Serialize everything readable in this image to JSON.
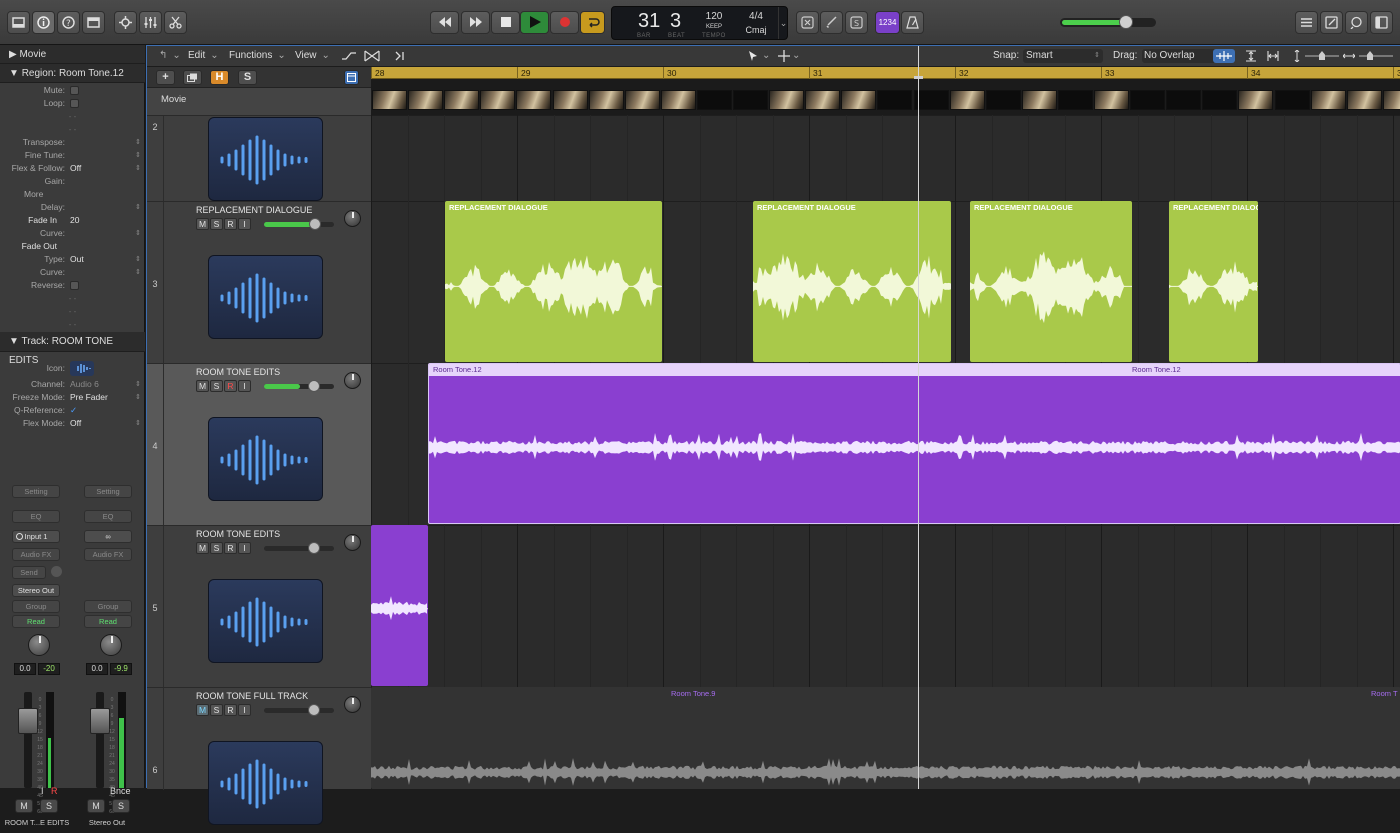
{
  "transport": {
    "bar": "31",
    "beat": "3",
    "bar_caption": "BAR",
    "beat_caption": "BEAT",
    "tempo": "120",
    "tempo_mode": "KEEP",
    "tempo_caption": "TEMPO",
    "signature": "4/4",
    "key": "Cmaj",
    "count_in": "1234"
  },
  "inspector": {
    "movie_header": "Movie",
    "region_label": "Region:",
    "region_name": "Room Tone.12",
    "region_params": [
      {
        "label": "Mute:",
        "value": ""
      },
      {
        "label": "Loop:",
        "value": ""
      },
      {
        "label": "Transpose:",
        "value": ""
      },
      {
        "label": "Fine Tune:",
        "value": ""
      },
      {
        "label": "Flex & Follow:",
        "value": "Off"
      },
      {
        "label": "Gain:",
        "value": ""
      },
      {
        "label": "More",
        "value": ""
      },
      {
        "label": "Delay:",
        "value": ""
      },
      {
        "label": "Fade In",
        "value": "20"
      },
      {
        "label": "Curve:",
        "value": ""
      },
      {
        "label": "Fade Out",
        "value": ""
      },
      {
        "label": "Type:",
        "value": "Out"
      },
      {
        "label": "Curve:",
        "value": ""
      },
      {
        "label": "Reverse:",
        "value": ""
      }
    ],
    "track_label": "Track:",
    "track_name": "ROOM TONE EDITS",
    "track_params": [
      {
        "label": "Icon:",
        "value": ""
      },
      {
        "label": "Channel:",
        "value": "Audio 6"
      },
      {
        "label": "Freeze Mode:",
        "value": "Pre Fader"
      },
      {
        "label": "Q-Reference:",
        "value": "✓"
      },
      {
        "label": "Flex Mode:",
        "value": "Off"
      }
    ]
  },
  "strips": [
    {
      "setting": "Setting",
      "eq": "EQ",
      "input": "Input 1",
      "fx": "Audio FX",
      "send": "Send",
      "output": "Stereo Out",
      "group": "Group",
      "auto": "Read",
      "vol": "0.0",
      "peak": "-20",
      "ir": [
        "I",
        "R"
      ],
      "m": "M",
      "s": "S",
      "name": "ROOM T...E EDITS"
    },
    {
      "setting": "Setting",
      "eq": "EQ",
      "input": "∞",
      "fx": "Audio FX",
      "send": "",
      "output": "",
      "group": "Group",
      "auto": "Read",
      "vol": "0.0",
      "peak": "-9.9",
      "ir": [
        "Bnce",
        ""
      ],
      "m": "M",
      "s": "S",
      "name": "Stereo Out"
    }
  ],
  "meter_scale": [
    "0",
    "3",
    "6",
    "9",
    "12",
    "15",
    "18",
    "21",
    "24",
    "30",
    "35",
    "40",
    "45",
    "50",
    "60"
  ],
  "local_menu": {
    "edit": "Edit",
    "functions": "Functions",
    "view": "View",
    "snap_label": "Snap:",
    "snap_value": "Smart",
    "drag_label": "Drag:",
    "drag_value": "No Overlap"
  },
  "header_buttons": {
    "add": "+",
    "hide": "H",
    "solo": "S"
  },
  "ruler_bars": [
    "28",
    "29",
    "30",
    "31",
    "32",
    "33",
    "34",
    "35"
  ],
  "movie_track": "Movie",
  "tracks": [
    {
      "number": "2",
      "name": ""
    },
    {
      "number": "3",
      "name": "REPLACEMENT DIALOGUE",
      "m": "M",
      "s": "S",
      "r": "R",
      "i": "I"
    },
    {
      "number": "4",
      "name": "ROOM TONE EDITS",
      "m": "M",
      "s": "S",
      "r": "R",
      "i": "I"
    },
    {
      "number": "5",
      "name": "ROOM TONE EDITS",
      "m": "M",
      "s": "S",
      "r": "R",
      "i": "I"
    },
    {
      "number": "6",
      "name": "ROOM TONE FULL TRACK",
      "m": "M",
      "s": "S",
      "r": "R",
      "i": "I"
    }
  ],
  "regions": {
    "dialogue_1": "REPLACEMENT DIALOGUE",
    "dialogue_2": "REPLACEMENT DIALOGUE",
    "dialogue_3": "REPLACEMENT DIALOGUE",
    "dialogue_4": "REPLACEMENT DIALOG",
    "roomtone_a": "Room Tone.12",
    "roomtone_b": "Room Tone.12",
    "roomtone_full_a": "Room Tone.9",
    "roomtone_full_b": "Room T"
  },
  "colors": {
    "dialogue": "#a9c94a",
    "roomtone": "#8a3fd0",
    "ruler": "#c7a53a",
    "play": "#2e8b3a",
    "record": "#d33"
  }
}
